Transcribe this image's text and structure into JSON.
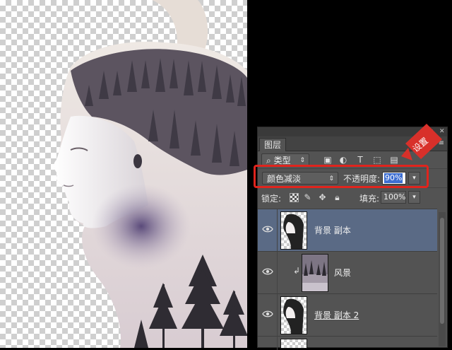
{
  "colors": {
    "panel_bg": "#535353",
    "selected_layer": "#5a6a85",
    "highlight": "#e0241d",
    "selection_blue": "#3d6ed2"
  },
  "canvas": {
    "background": "transparent-checkerboard",
    "subject": "double-exposure female profile with pine forest"
  },
  "layers_panel": {
    "title_bar_icons": [
      "collapse-icon",
      "close-icon"
    ],
    "tab_label": "图层",
    "filter": {
      "kind_label": "类型",
      "icons": [
        "image-filter-icon",
        "adjustment-filter-icon",
        "type-filter-icon",
        "shape-filter-icon",
        "smart-object-filter-icon"
      ]
    },
    "blend_mode": "颜色减淡",
    "opacity_label": "不透明度:",
    "opacity_value": "90%",
    "lock_label": "锁定:",
    "fill_label": "填充:",
    "fill_value": "100%",
    "layers": [
      {
        "name": "背景 副本",
        "visible": true,
        "selected": true,
        "clipped": false
      },
      {
        "name": "风景",
        "visible": true,
        "selected": false,
        "clipped": true
      },
      {
        "name": "背景 副本 2",
        "visible": true,
        "selected": false,
        "clipped": false
      }
    ]
  },
  "callout": {
    "text": "设置"
  }
}
